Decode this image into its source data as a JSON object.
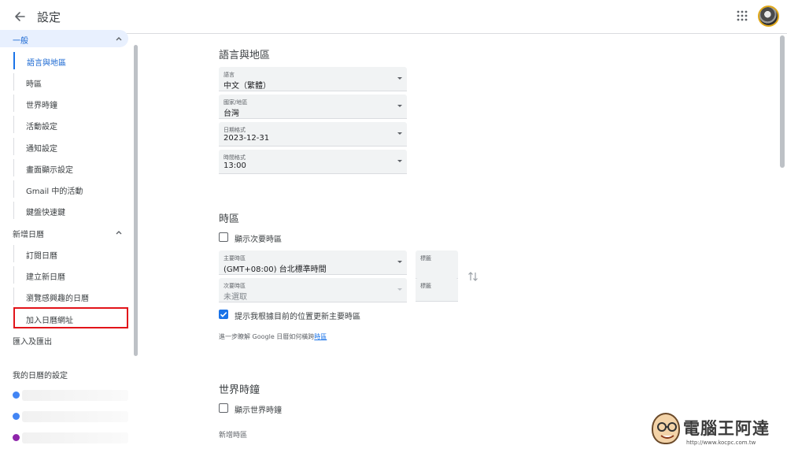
{
  "header": {
    "title": "設定"
  },
  "sidebar": {
    "general": {
      "label": "一般",
      "items": [
        {
          "label": "語言與地區"
        },
        {
          "label": "時區"
        },
        {
          "label": "世界時鐘"
        },
        {
          "label": "活動設定"
        },
        {
          "label": "通知設定"
        },
        {
          "label": "畫面顯示設定"
        },
        {
          "label": "Gmail 中的活動"
        },
        {
          "label": "鍵盤快速鍵"
        }
      ]
    },
    "add_calendar": {
      "label": "新增日曆",
      "items": [
        {
          "label": "訂閱日曆"
        },
        {
          "label": "建立新日曆"
        },
        {
          "label": "瀏覽感興趣的日曆"
        },
        {
          "label": "加入日曆網址"
        }
      ]
    },
    "import_export": "匯入及匯出",
    "my_calendars": "我的日曆的設定",
    "calendar_colors": [
      "#4285f4",
      "#4285f4",
      "#8e24aa"
    ]
  },
  "language_region": {
    "title": "語言與地區",
    "fields": [
      {
        "caption": "語言",
        "value": "中文（繁體）"
      },
      {
        "caption": "國家/地區",
        "value": "台灣"
      },
      {
        "caption": "日期格式",
        "value": "2023-12-31"
      },
      {
        "caption": "時間格式",
        "value": "13:00"
      }
    ]
  },
  "timezone": {
    "title": "時區",
    "show_secondary": {
      "label": "顯示次要時區",
      "checked": false
    },
    "primary": {
      "caption": "主要時區",
      "value": "(GMT+08:00) 台北標準時間",
      "tag_caption": "標籤"
    },
    "secondary": {
      "caption": "次要時區",
      "value": "未選取",
      "tag_caption": "標籤"
    },
    "auto_update": {
      "label": "提示我根據目前的位置更新主要時區",
      "checked": true
    },
    "helper_prefix": "進一步瞭解 Google 日曆如何橫跨",
    "helper_link": "時區"
  },
  "world_clock": {
    "title": "世界時鐘",
    "show": {
      "label": "顯示世界時鐘",
      "checked": false
    },
    "add_label": "新增時區"
  },
  "watermark": {
    "brand": "電腦王阿達",
    "url": "http://www.kocpc.com.tw"
  }
}
